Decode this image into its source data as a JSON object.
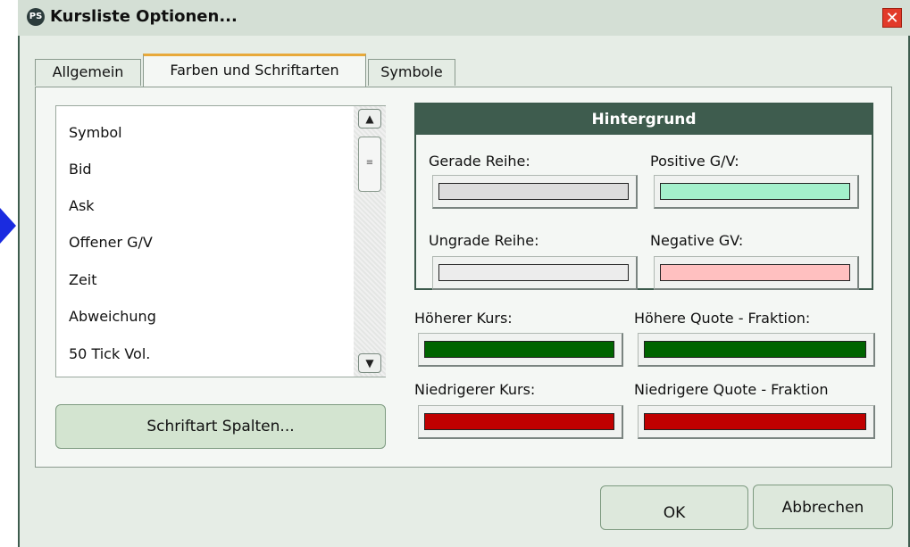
{
  "window": {
    "title": "Kursliste Optionen...",
    "app_icon_text": "PS",
    "close_glyph": "✕"
  },
  "tabs": [
    {
      "label": "Allgemein"
    },
    {
      "label": "Farben und Schriftarten",
      "active": true
    },
    {
      "label": "Symbole"
    }
  ],
  "column_list": {
    "items": [
      "Symbol",
      "Bid",
      "Ask",
      "Offener G/V",
      "Zeit",
      "Abweichung",
      "50 Tick Vol."
    ],
    "scroll_up_glyph": "▲",
    "scroll_down_glyph": "▼",
    "thumb_grip": "≡"
  },
  "font_button": {
    "label": "Schriftart Spalten..."
  },
  "background_group": {
    "header": "Hintergrund",
    "even_row": {
      "label": "Gerade Reihe:",
      "color": "#dcdcdc"
    },
    "positive_pl": {
      "label": "Positive G/V:",
      "color": "#a4f0cc"
    },
    "odd_row": {
      "label": "Ungrade Reihe:",
      "color": "#ececec"
    },
    "negative_pl": {
      "label": "Negative GV:",
      "color": "#ffc0c0"
    }
  },
  "price_colors": {
    "higher_price": {
      "label": "Höherer Kurs:",
      "color": "#006400"
    },
    "higher_quote": {
      "label": "Höhere Quote - Fraktion:",
      "color": "#006400"
    },
    "lower_price": {
      "label": "Niedrigerer Kurs:",
      "color": "#c00000"
    },
    "lower_quote": {
      "label": "Niedrigere Quote - Fraktion",
      "color": "#c00000"
    }
  },
  "buttons": {
    "ok": "OK",
    "cancel": "Abbrechen"
  }
}
